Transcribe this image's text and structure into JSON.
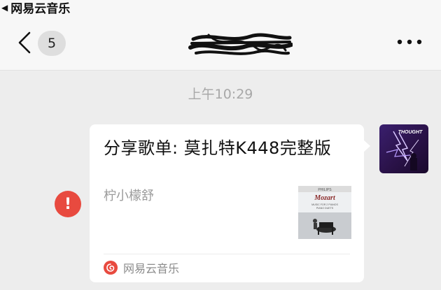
{
  "status_bar": {
    "back_app_label": "网易云音乐"
  },
  "nav": {
    "unread_count": "5"
  },
  "messages": {
    "timestamp": "上午10:29",
    "share_card": {
      "title": "分享歌单: 莫扎特K448完整版",
      "author": "柠小檬舒",
      "source_label": "网易云音乐",
      "source_color": "#e84a3f"
    }
  },
  "album_cover": {
    "brand": "PHILIPS",
    "artist": "Mozart",
    "subtitle_line1": "MUSIC FOR 2 PIANOS",
    "subtitle_line2": "PIANO DUETS"
  },
  "avatar": {
    "text": "THOUGHT"
  },
  "colors": {
    "background": "#ededed",
    "navbar": "#f7f7f7",
    "error_red": "#e84a3f"
  }
}
